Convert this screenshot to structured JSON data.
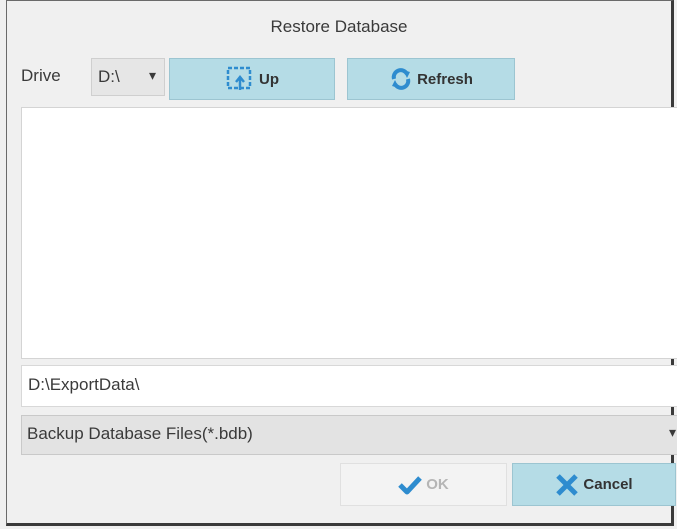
{
  "dialog": {
    "title": "Restore Database"
  },
  "drive": {
    "label": "Drive",
    "value": "D:\\",
    "caret": "▾"
  },
  "toolbar": {
    "up_label": "Up",
    "up_icon": "folder-up-icon",
    "refresh_label": "Refresh",
    "refresh_icon": "refresh-icon"
  },
  "file_list": {
    "items": []
  },
  "path": {
    "value": "D:\\ExportData\\"
  },
  "filter": {
    "value": "Backup Database Files(*.bdb)",
    "caret": "▾"
  },
  "actions": {
    "ok_label": "OK",
    "ok_icon": "checkmark-icon",
    "cancel_label": "Cancel",
    "cancel_icon": "x-icon"
  },
  "colors": {
    "button_fill": "#b5dce6",
    "icon_blue": "#2e8ccf",
    "disabled_fill": "#f3f3f3"
  }
}
